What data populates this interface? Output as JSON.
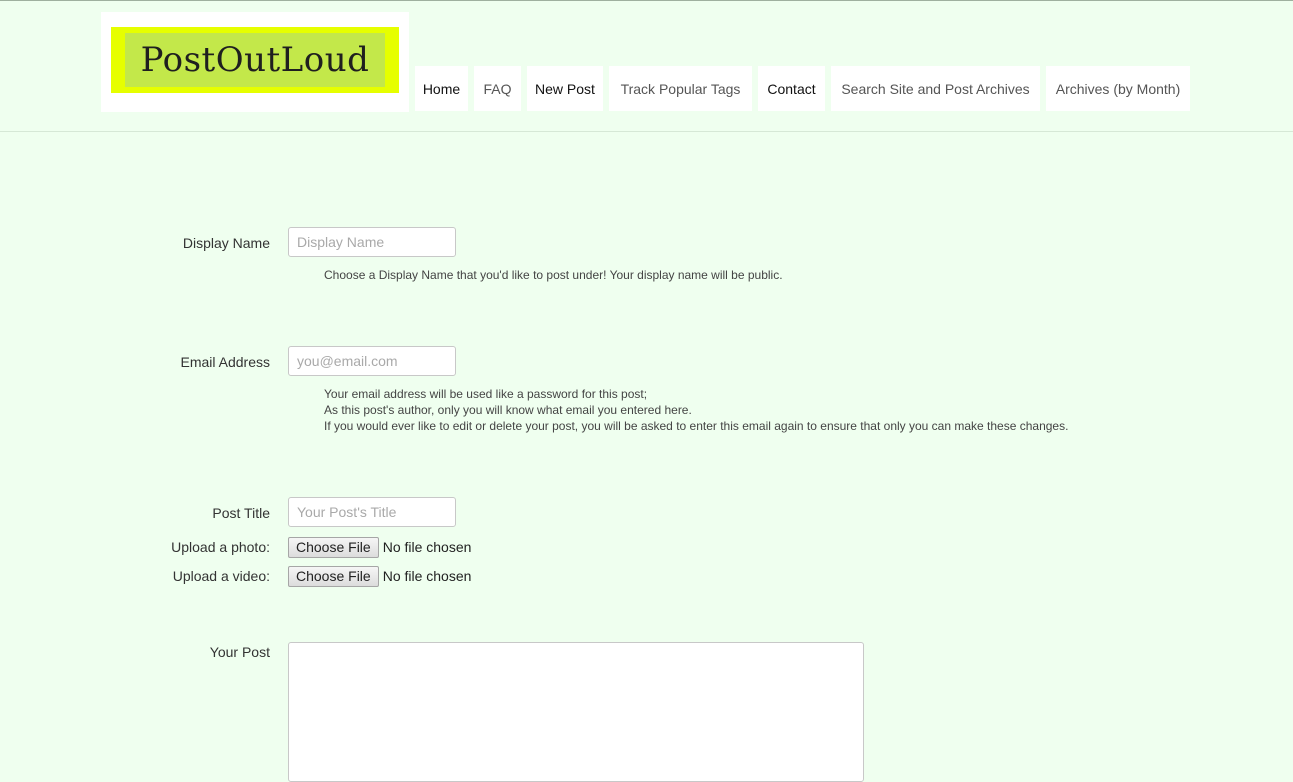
{
  "site": {
    "logo_text": "PostOutLoud"
  },
  "nav": {
    "items": [
      {
        "label": "Home"
      },
      {
        "label": "FAQ"
      },
      {
        "label": "New Post"
      },
      {
        "label": "Track Popular Tags"
      },
      {
        "label": "Contact"
      },
      {
        "label": "Search Site and Post Archives"
      },
      {
        "label": "Archives (by Month)"
      }
    ]
  },
  "form": {
    "display_name": {
      "label": "Display Name",
      "placeholder": "Display Name",
      "help": "Choose a Display Name that you'd like to post under! Your display name will be public."
    },
    "email": {
      "label": "Email Address",
      "placeholder": "you@email.com",
      "help_lines": [
        "Your email address will be used like a password for this post;",
        "As this post's author, only you will know what email you entered here.",
        "If you would ever like to edit or delete your post, you will be asked to enter this email again to ensure that only you can make these changes."
      ]
    },
    "post_title": {
      "label": "Post Title",
      "placeholder": "Your Post's Title"
    },
    "photo": {
      "label": "Upload a photo:",
      "button": "Choose File",
      "status": "No file chosen"
    },
    "video": {
      "label": "Upload a video:",
      "button": "Choose File",
      "status": "No file chosen"
    },
    "post_body": {
      "label": "Your Post"
    }
  },
  "colors": {
    "page_background": "#efffef",
    "logo_outer": "#e6ff00",
    "logo_inner": "#c3e84a"
  }
}
